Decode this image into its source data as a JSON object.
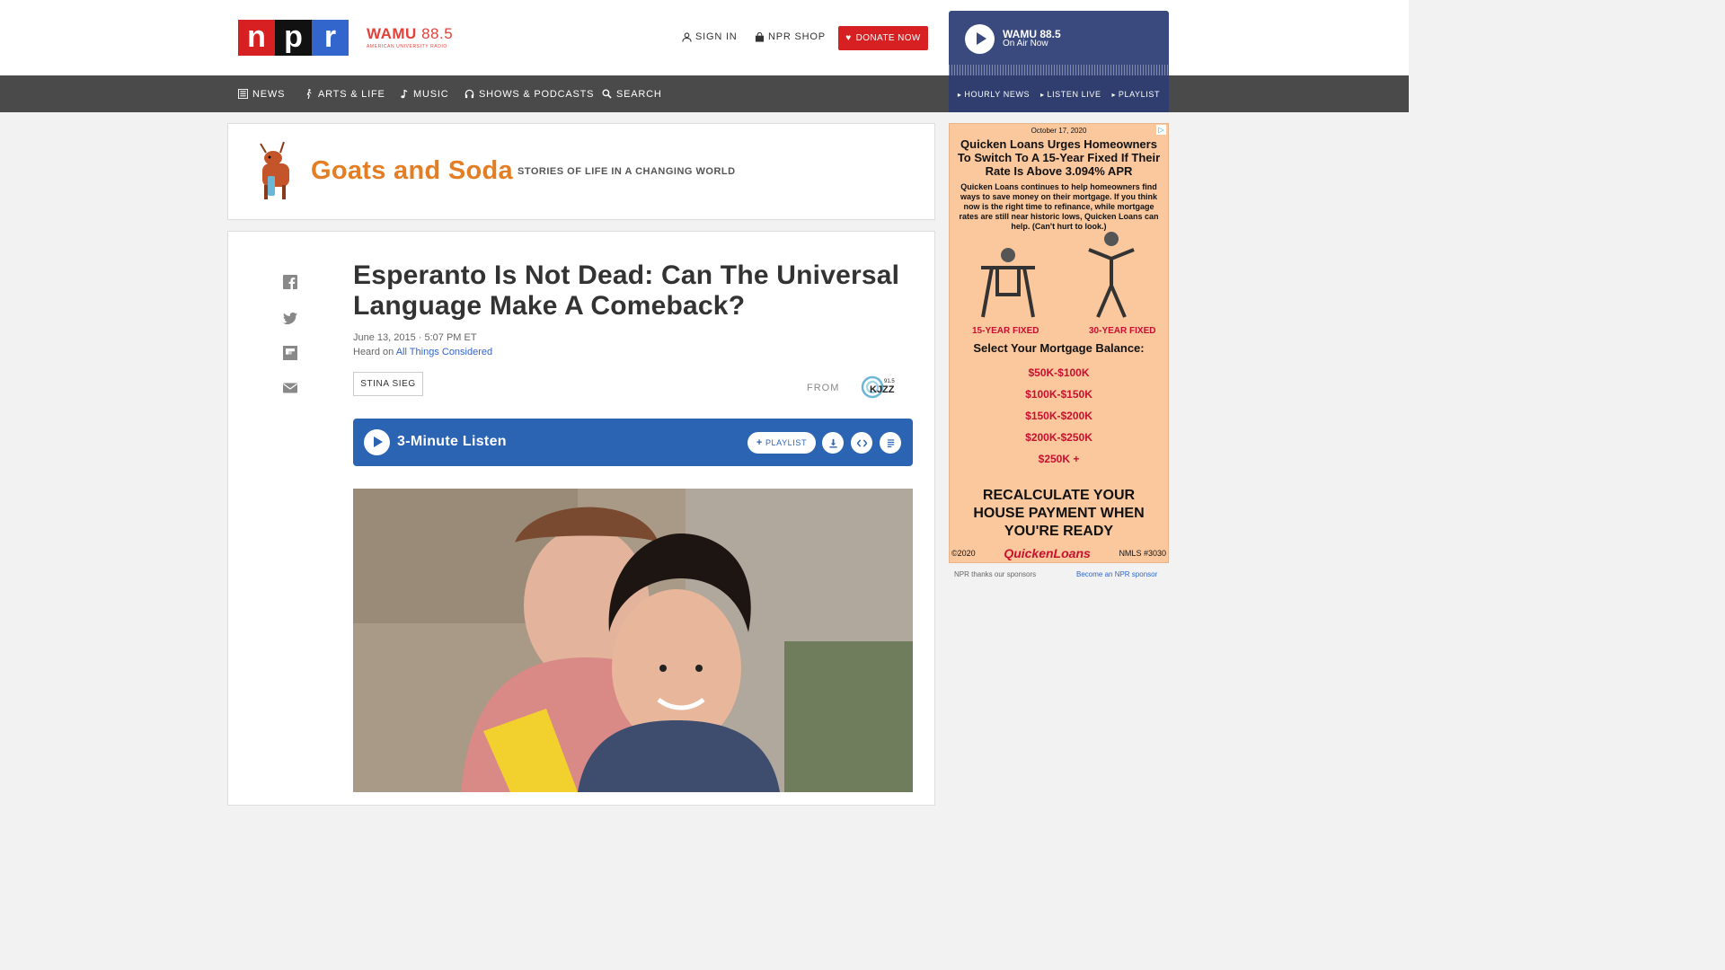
{
  "header": {
    "logo_letters": [
      "n",
      "p",
      "r"
    ],
    "station": {
      "name": "WAMU",
      "freq": "88.5",
      "sub": "AMERICAN UNIVERSITY RADIO"
    },
    "sign_in": "SIGN IN",
    "shop": "NPR SHOP",
    "donate": "DONATE NOW"
  },
  "nav": [
    {
      "label": "NEWS",
      "icon": "news-icon"
    },
    {
      "label": "ARTS & LIFE",
      "icon": "arts-icon"
    },
    {
      "label": "MUSIC",
      "icon": "music-note-icon"
    },
    {
      "label": "SHOWS & PODCASTS",
      "icon": "headphones-icon"
    },
    {
      "label": "SEARCH",
      "icon": "search-icon"
    }
  ],
  "player": {
    "station": "WAMU 88.5",
    "status": "On Air Now",
    "links": [
      "HOURLY NEWS",
      "LISTEN LIVE",
      "PLAYLIST"
    ]
  },
  "blog": {
    "title": "Goats and Soda",
    "tagline": "STORIES OF LIFE IN A CHANGING WORLD"
  },
  "article": {
    "headline": "Esperanto Is Not Dead: Can The Universal Language Make A Comeback?",
    "date": "June 13, 2015 · 5:07 PM ET",
    "heard_on_prefix": "Heard on",
    "heard_on_show": "All Things Considered",
    "byline": "STINA SIEG",
    "from_label": "FROM",
    "from_station": "KJZZ",
    "from_freq": "91.5",
    "share_icons": [
      "facebook-icon",
      "twitter-icon",
      "flipboard-icon",
      "email-icon"
    ]
  },
  "audio": {
    "label": "3-Minute Listen",
    "playlist": "PLAYLIST"
  },
  "ad": {
    "date": "October 17, 2020",
    "headline": "Quicken Loans Urges Homeowners To Switch To A 15-Year Fixed If Their Rate Is Above 3.094% APR",
    "body": "Quicken Loans continues to help homeowners find ways to save money on their mortgage. If you think now is the right time to refinance, while mortgage rates are still near historic lows, Quicken Loans can help. (Can't hurt to look.)",
    "label_left": "15-YEAR FIXED",
    "label_right": "30-YEAR FIXED",
    "select": "Select Your Mortgage Balance:",
    "ranges": [
      "$50K-$100K",
      "$100K-$150K",
      "$150K-$200K",
      "$200K-$250K",
      "$250K +"
    ],
    "cta": "RECALCULATE YOUR HOUSE PAYMENT WHEN YOU'RE READY",
    "copyright": "©2020",
    "brand": "QuickenLoans",
    "nmls": "NMLS #3030",
    "colors": {
      "bg": "#fbc89e",
      "accent": "#c8102e"
    }
  },
  "sponsor": {
    "thanks": "NPR thanks our sponsors",
    "become": "Become an NPR sponsor"
  }
}
